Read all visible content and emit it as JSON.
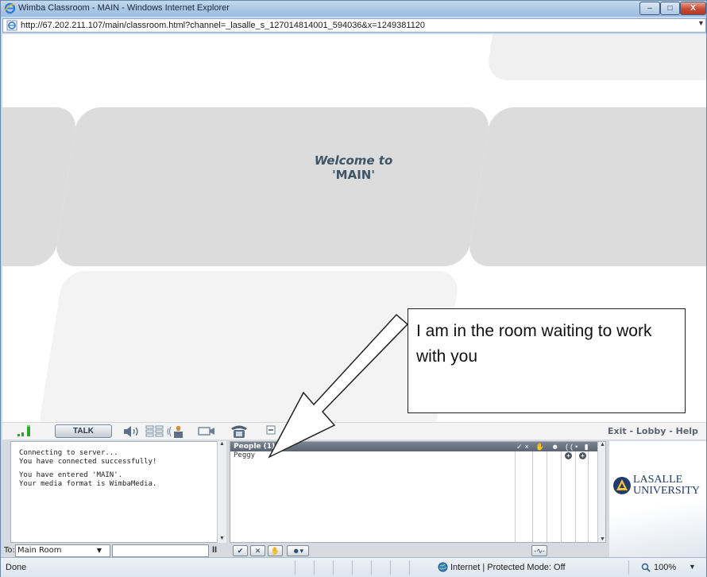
{
  "window": {
    "title": "Wimba Classroom - MAIN - Windows Internet Explorer",
    "controls": {
      "minimize": "–",
      "maximize": "□",
      "close": "X"
    }
  },
  "address_bar": {
    "url": "http://67.202.211.107/main/classroom.html?channel=_lasalle_s_127014814001_594036&x=1249381120"
  },
  "stage": {
    "welcome_line1": "Welcome to",
    "welcome_line2": "'MAIN'"
  },
  "callout": {
    "text": "I am in the room waiting to work with you"
  },
  "toolbar": {
    "talk_label": "TALK",
    "exit": "Exit",
    "lobby": "Lobby",
    "help": "Help",
    "separator": " - ",
    "signal_color": "#2da42d"
  },
  "log": {
    "lines": [
      "Connecting to server...",
      "You have connected successfully!",
      "You have entered 'MAIN'.",
      "Your media format is WimbaMedia."
    ]
  },
  "people": {
    "header": "People (1)",
    "header_icons": "✓× ✋ ☻ ((• ▮",
    "members": [
      "Peggy"
    ]
  },
  "logo": {
    "line1": "LASALLE",
    "line2": "UNIVERSITY"
  },
  "chat": {
    "to_label": "To:",
    "room": "Main Room",
    "input_value": "",
    "pause": "II"
  },
  "status_bar": {
    "status": "Done",
    "zone": "Internet | Protected Mode: Off",
    "zoom": "100%"
  }
}
